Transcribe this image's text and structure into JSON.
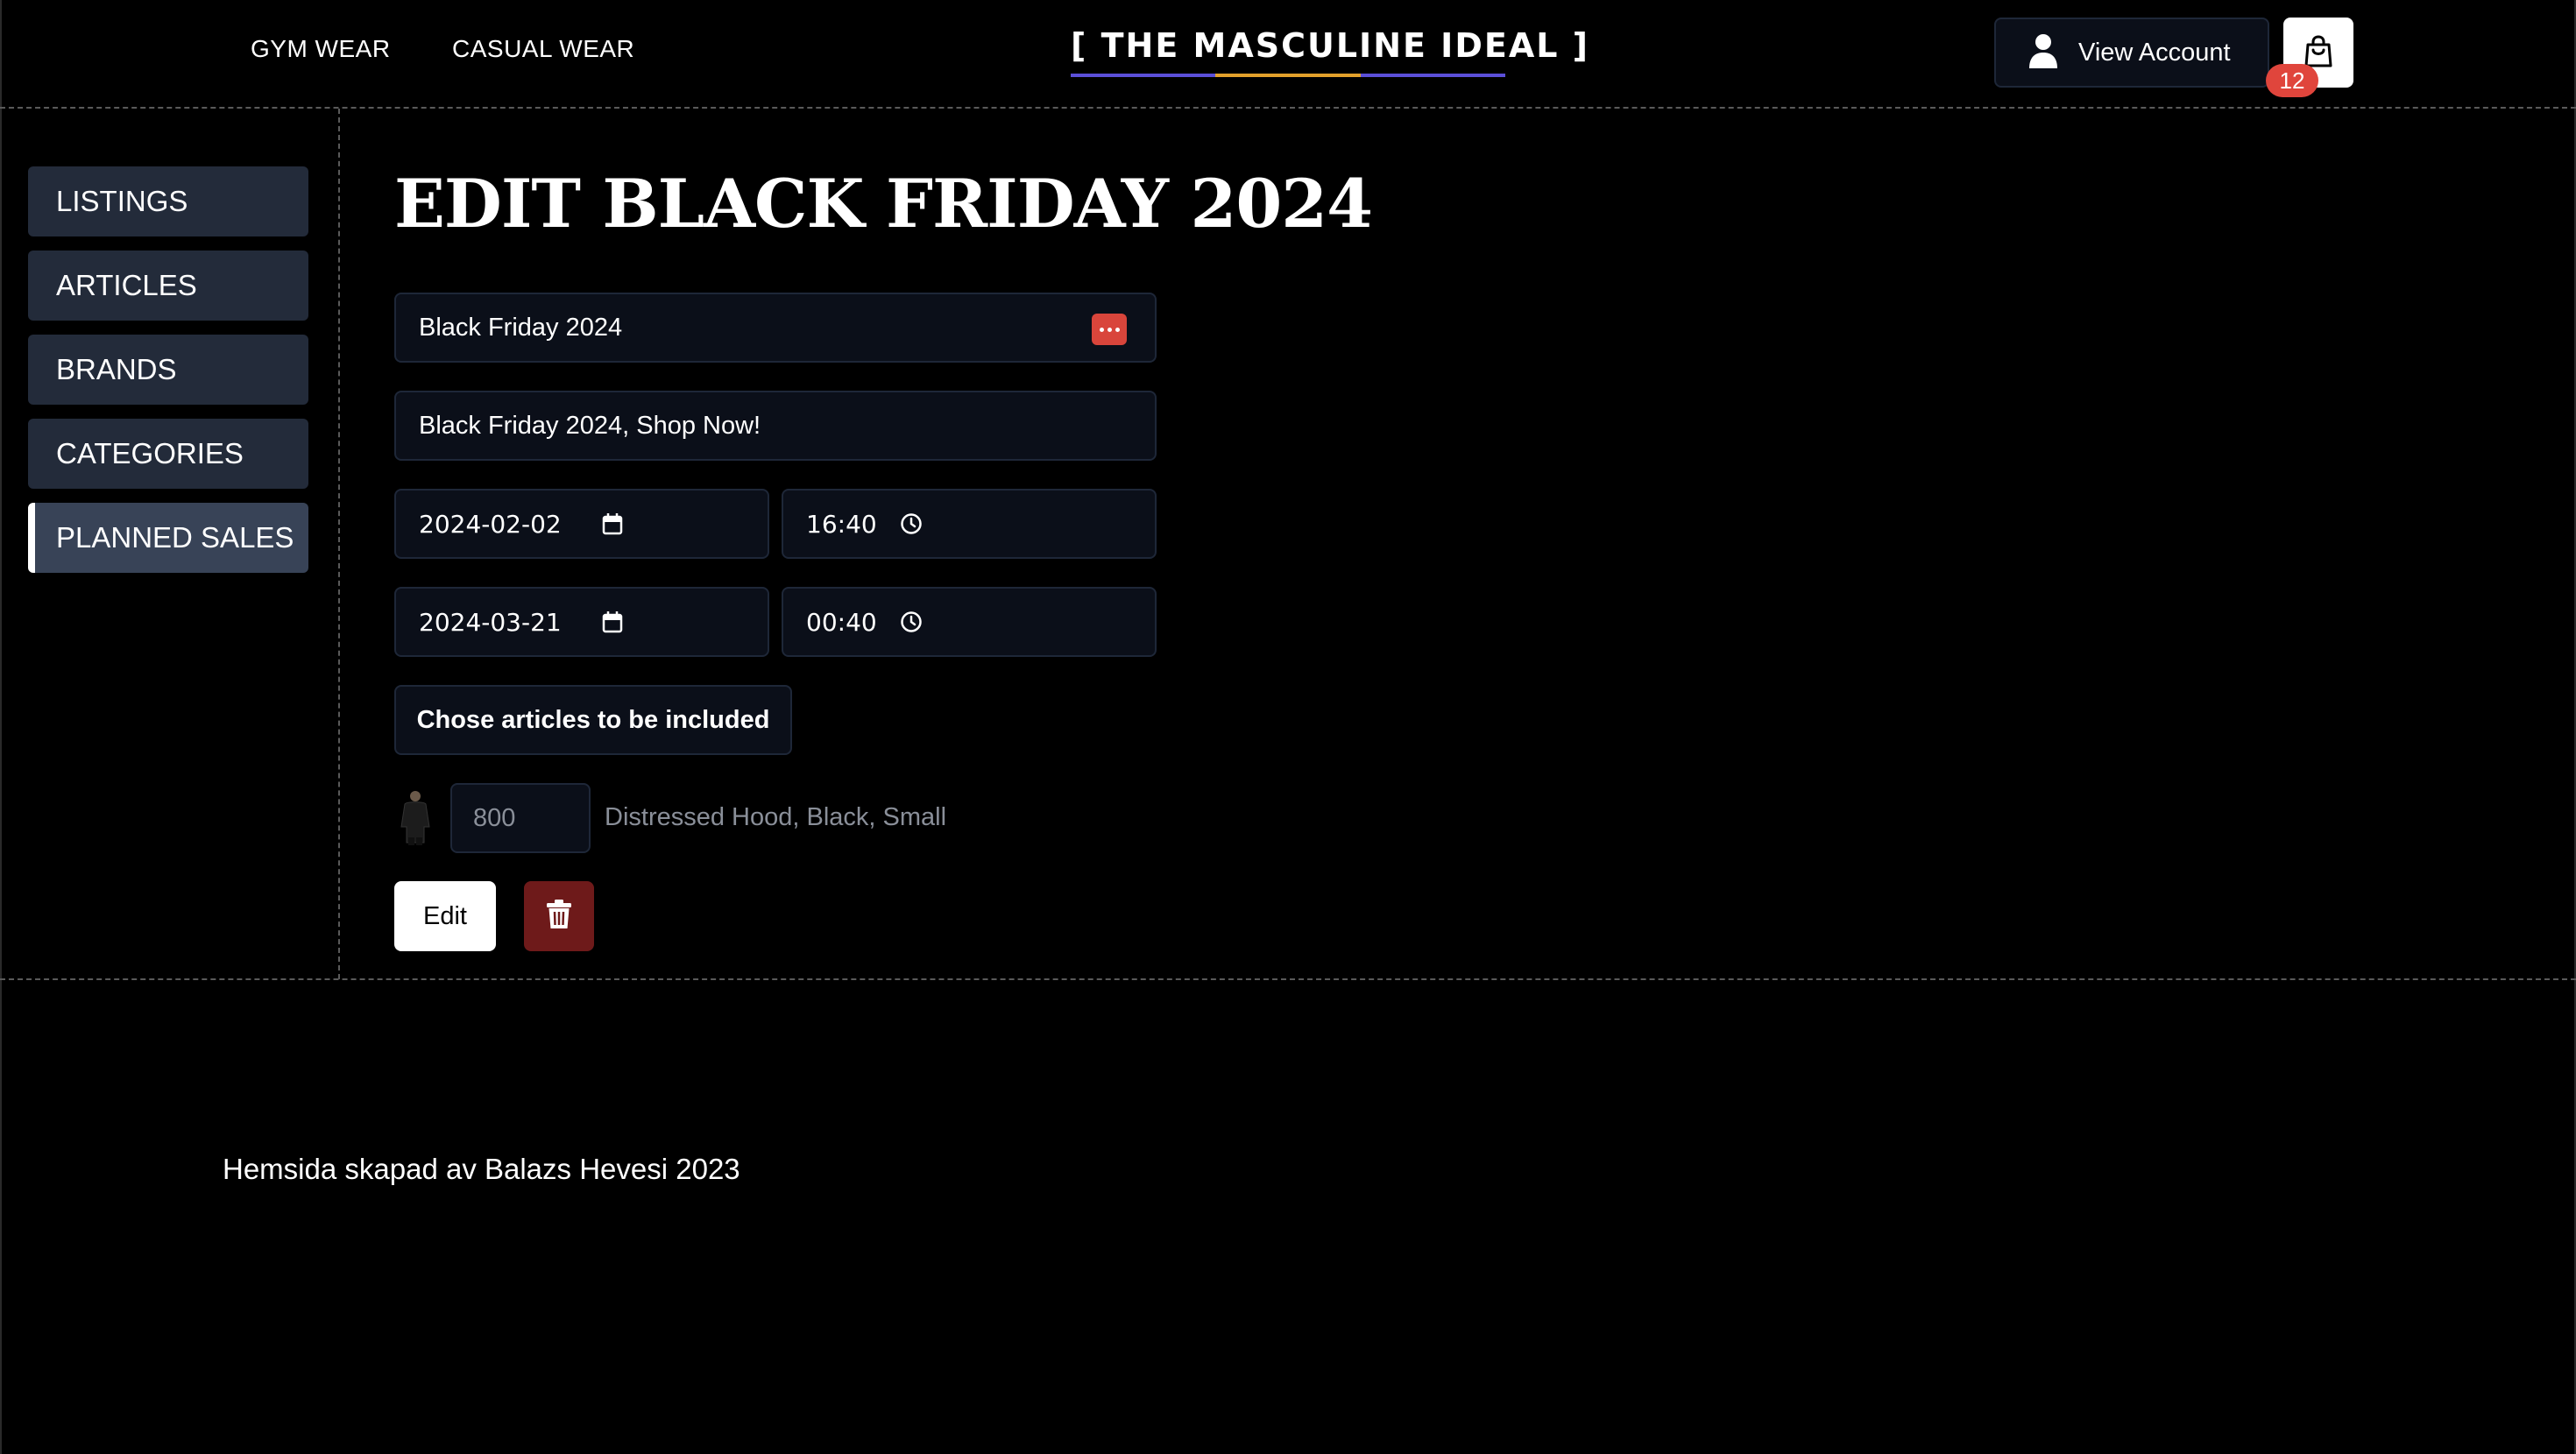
{
  "header": {
    "nav": [
      {
        "label": "GYM WEAR"
      },
      {
        "label": "CASUAL WEAR"
      }
    ],
    "logo_text": "[ THE MASCULINE IDEAL ]",
    "logo_colors": [
      "#5b4fd8",
      "#e3a12b",
      "#5b4fd8"
    ],
    "account_label": "View Account",
    "cart_count": "12"
  },
  "sidebar": {
    "items": [
      {
        "label": "LISTINGS",
        "active": false
      },
      {
        "label": "ARTICLES",
        "active": false
      },
      {
        "label": "BRANDS",
        "active": false
      },
      {
        "label": "CATEGORIES",
        "active": false
      },
      {
        "label": "PLANNED SALES",
        "active": true
      }
    ]
  },
  "main": {
    "title": "EDIT BLACK FRIDAY 2024",
    "name_value": "Black Friday 2024",
    "slogan_value": "Black Friday 2024, Shop Now!",
    "start_date": "2024-02-02",
    "start_time": "16:40",
    "end_date": "2024-03-21",
    "end_time": "00:40",
    "choose_articles_label": "Chose articles to be included",
    "articles": [
      {
        "quantity_placeholder": "800",
        "name": "Distressed Hood, Black, Small"
      }
    ],
    "edit_label": "Edit"
  },
  "footer": {
    "text": "Hemsida skapad av Balazs Hevesi 2023"
  },
  "colors": {
    "background": "#000000",
    "field_bg": "#0b0f19",
    "sidebar_item": "#232b3a",
    "sidebar_active": "#384357",
    "badge": "#e0453c",
    "delete_button": "#6e1a1a"
  }
}
